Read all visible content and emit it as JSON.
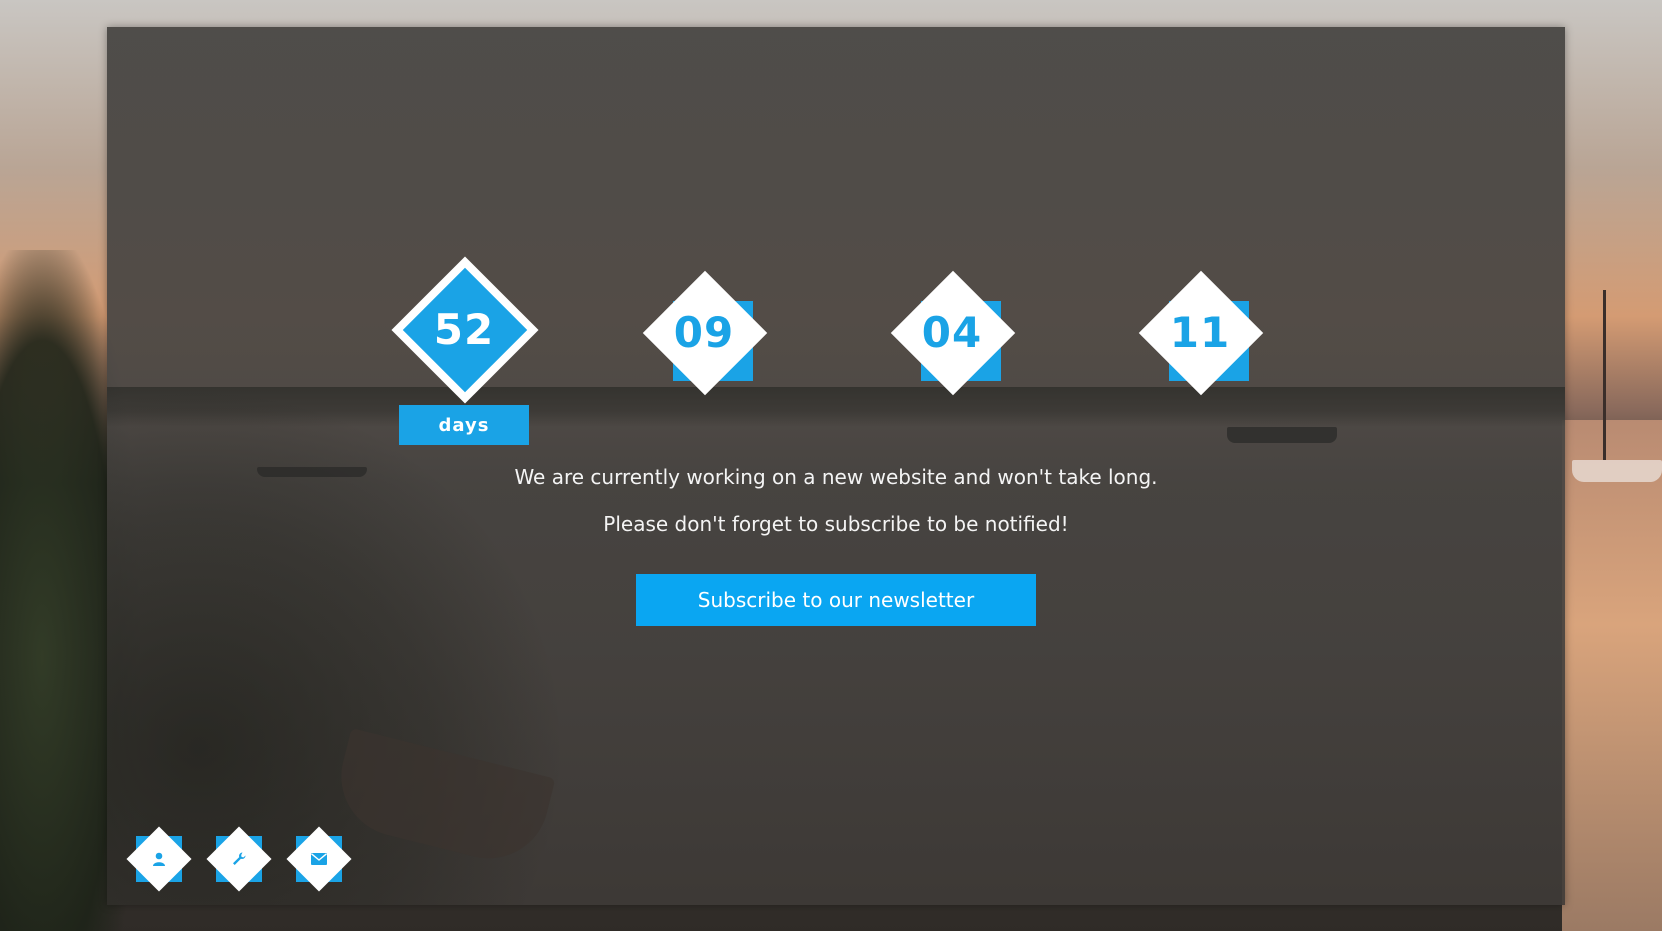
{
  "countdown": {
    "days": {
      "value": "52",
      "label": "days"
    },
    "hours": {
      "value": "09"
    },
    "minutes": {
      "value": "04"
    },
    "seconds": {
      "value": "11"
    }
  },
  "message": {
    "line1": "We are currently working on a new website and won't take long.",
    "line2": "Please don't forget to subscribe to be notified!"
  },
  "subscribe": {
    "label": "Subscribe to our newsletter"
  },
  "social": [
    {
      "icon": "user-icon"
    },
    {
      "icon": "wrench-icon"
    },
    {
      "icon": "envelope-icon"
    }
  ],
  "colors": {
    "accent": "#1aa3e6",
    "panel": "#46443f",
    "text": "#f4f4f4"
  }
}
